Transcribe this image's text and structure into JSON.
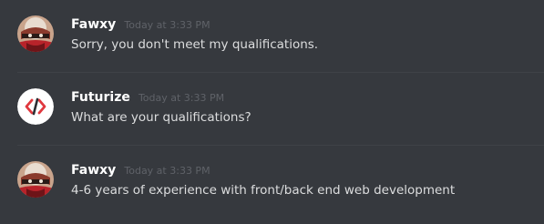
{
  "messages": [
    {
      "username": "Fawxy",
      "timestamp": "Today at 3:33 PM",
      "text": "Sorry, you don't meet my qualifications.",
      "avatar": "fawxy-avatar"
    },
    {
      "username": "Futurize",
      "timestamp": "Today at 3:33 PM",
      "text": "What are your qualifications?",
      "avatar": "futurize-code-avatar"
    },
    {
      "username": "Fawxy",
      "timestamp": "Today at 3:33 PM",
      "text": "4-6 years of experience with front/back end web development",
      "avatar": "fawxy-avatar"
    }
  ],
  "colors": {
    "background": "#36393e",
    "username": "#ffffff",
    "timestamp": "#5f6268",
    "message_text": "#dcddde",
    "futurize_brand": "#e0383e"
  }
}
